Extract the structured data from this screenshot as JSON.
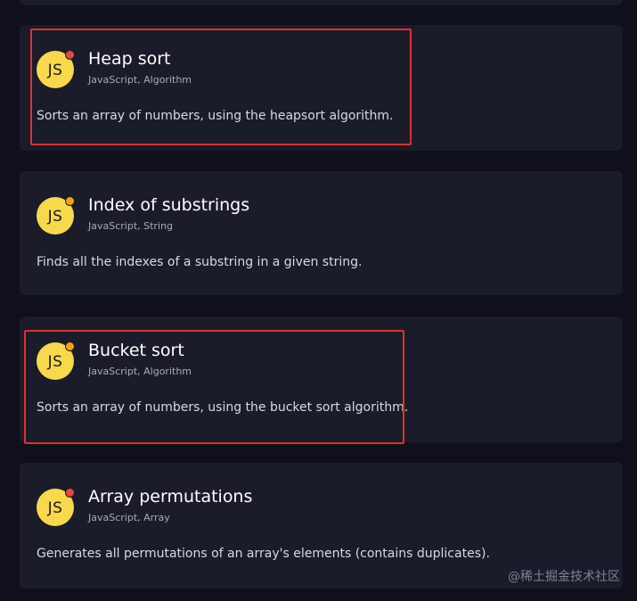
{
  "cards": [
    {
      "icon_text": "JS",
      "status_color": "#e24b3d",
      "title": "Heap sort",
      "tags": "JavaScript, Algorithm",
      "description": "Sorts an array of numbers, using the heapsort algorithm."
    },
    {
      "icon_text": "JS",
      "status_color": "#f4a30f",
      "title": "Index of substrings",
      "tags": "JavaScript, String",
      "description": "Finds all the indexes of a substring in a given string."
    },
    {
      "icon_text": "JS",
      "status_color": "#f4a30f",
      "title": "Bucket sort",
      "tags": "JavaScript, Algorithm",
      "description": "Sorts an array of numbers, using the bucket sort algorithm."
    },
    {
      "icon_text": "JS",
      "status_color": "#e24b3d",
      "title": "Array permutations",
      "tags": "JavaScript, Array",
      "description": "Generates all permutations of an array's elements (contains duplicates)."
    }
  ],
  "highlight_color": "#e0302a",
  "watermark": "@稀土掘金技术社区"
}
